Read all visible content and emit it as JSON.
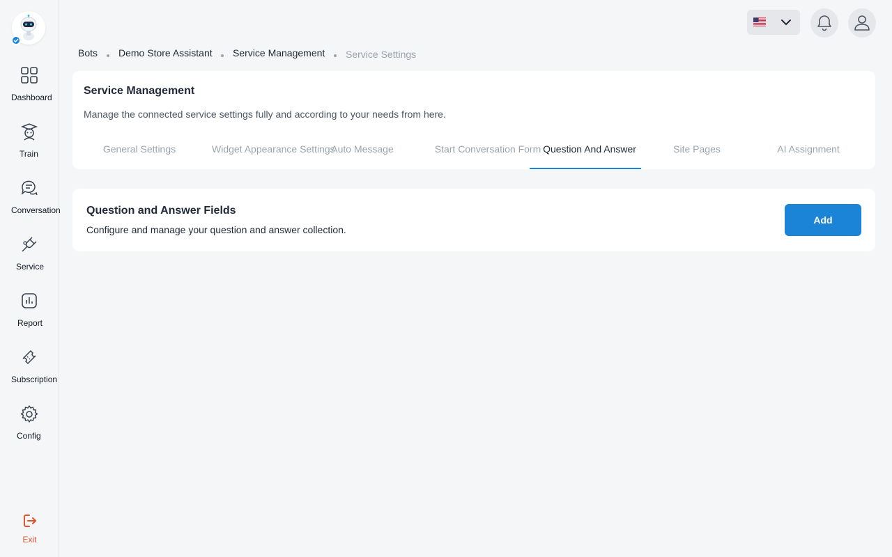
{
  "sidebar": {
    "items": [
      {
        "label": "Dashboard",
        "icon": "dashboard-icon"
      },
      {
        "label": "Train",
        "icon": "train-icon"
      },
      {
        "label": "Conversation",
        "icon": "conversation-icon"
      },
      {
        "label": "Service",
        "icon": "plug-icon"
      },
      {
        "label": "Report",
        "icon": "report-icon"
      },
      {
        "label": "Subscription",
        "icon": "ticket-icon"
      },
      {
        "label": "Config",
        "icon": "gear-icon"
      }
    ],
    "exit_label": "Exit"
  },
  "topbar": {
    "language_flag": "us-flag-icon",
    "notification_icon": "bell-icon",
    "profile_icon": "user-icon"
  },
  "breadcrumb": [
    "Bots",
    "Demo Store Assistant",
    "Service Management",
    "Service Settings"
  ],
  "header": {
    "title": "Service Management",
    "description": "Manage the connected service settings fully and according to your needs from here.",
    "tabs": [
      "General Settings",
      "Widget Appearance Settings",
      "Auto Message",
      "Start Conversation Form",
      "Question And Answer",
      "Site Pages",
      "AI Assignment"
    ],
    "active_tab": "Question And Answer"
  },
  "qa_section": {
    "title": "Question and Answer Fields",
    "description": "Configure and manage your question and answer collection.",
    "add_label": "Add"
  },
  "colors": {
    "accent": "#1c84d6",
    "exit": "#e5512c",
    "background": "#f4f6f8"
  }
}
